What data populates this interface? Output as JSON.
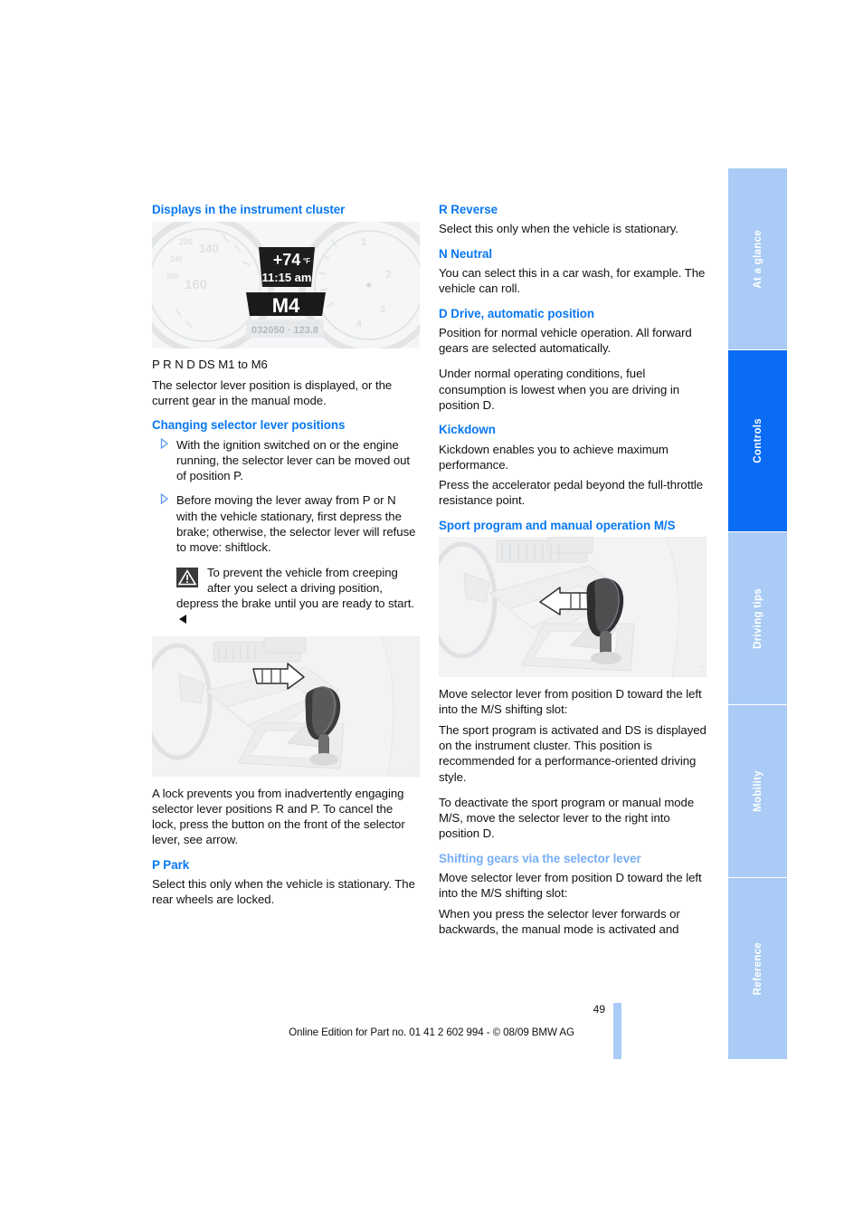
{
  "tabs": [
    {
      "label": "At a glance",
      "active": false
    },
    {
      "label": "Controls",
      "active": true
    },
    {
      "label": "Driving tips",
      "active": false
    },
    {
      "label": "Mobility",
      "active": false
    },
    {
      "label": "Reference",
      "active": false
    }
  ],
  "colors": {
    "heading_blue": "#0a78f0",
    "heading_blue_pale": "#77aef4",
    "tab_inactive": "#a9cbf5",
    "tab_active": "#0a6cf5"
  },
  "left": {
    "h_displays": "Displays in the instrument cluster",
    "cluster_figure": {
      "temperature": "+74",
      "temp_unit": "°F",
      "clock": "11:15 am",
      "gear": "M4",
      "odometer": "032050",
      "trip": "123.8",
      "speed_marks": [
        "220",
        "140",
        "240",
        "260",
        "160"
      ],
      "tach_marks": [
        "1",
        "2",
        "3",
        "4"
      ]
    },
    "positions_line": "P R N D DS M1 to M6",
    "positions_desc": "The selector lever position is displayed, or the current gear in the manual mode.",
    "h_changing": "Changing selector lever positions",
    "bullet1": "With the ignition switched on or the engine running, the selector lever can be moved out of position P.",
    "bullet2": "Before moving the lever away from P or N with the vehicle stationary, first depress the brake; otherwise, the selector lever will refuse to move: shiftlock.",
    "warning_line1": "To prevent the vehicle from creeping",
    "warning_line2": "after you select a driving position,",
    "warning_rest": "depress the brake until you are ready to start.",
    "lever_caption": "A lock prevents you from inadvertently engaging selector lever positions R and P. To cancel the lock, press the button on the front of the selector lever, see arrow.",
    "h_park": "P Park",
    "park_desc": "Select this only when the vehicle is stationary. The rear wheels are locked."
  },
  "right": {
    "h_reverse": "R Reverse",
    "reverse_desc": "Select this only when the vehicle is stationary.",
    "h_neutral": "N Neutral",
    "neutral_desc": "You can select this in a car wash, for example. The vehicle can roll.",
    "h_drive": "D Drive, automatic position",
    "drive_desc1": "Position for normal vehicle operation. All forward gears are selected automatically.",
    "drive_desc2": "Under normal operating conditions, fuel consumption is lowest when you are driving in position D.",
    "h_kickdown": "Kickdown",
    "kickdown_desc1": "Kickdown enables you to achieve maximum performance.",
    "kickdown_desc2": "Press the accelerator pedal beyond the full-throttle resistance point.",
    "h_sport": "Sport program and manual operation M/S",
    "sport_desc1": "Move selector lever from position D toward the left into the M/S shifting slot:",
    "sport_desc2": "The sport program is activated and DS is displayed on the instrument cluster. This position is recommended for a performance-oriented driving style.",
    "sport_desc3": "To deactivate the sport program or manual mode M/S, move the selector lever to the right into position D.",
    "h_shifting": "Shifting gears via the selector lever",
    "shifting_desc1": "Move selector lever from position D toward the left into the M/S shifting slot:",
    "shifting_desc2": "When you press the selector lever forwards or backwards, the manual mode is activated and"
  },
  "footer": {
    "page_number": "49",
    "edition": "Online Edition for Part no. 01 41 2 602 994 - © 08/09 BMW AG"
  }
}
